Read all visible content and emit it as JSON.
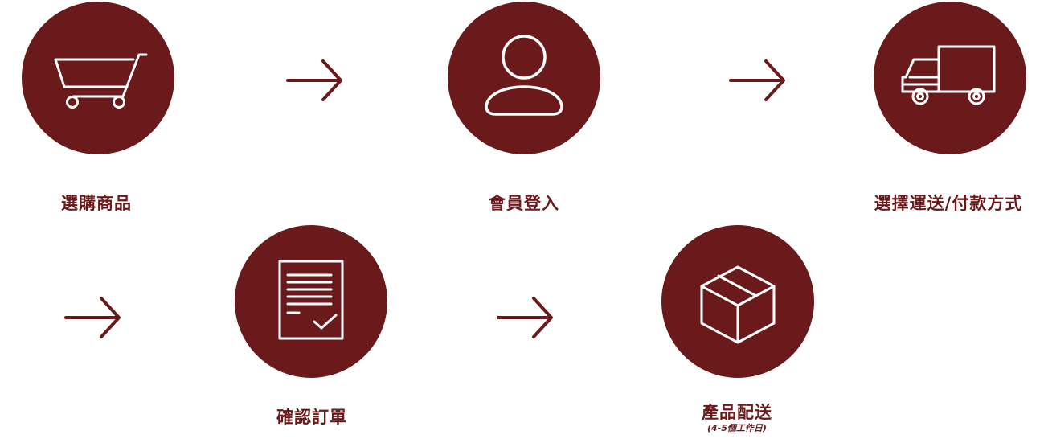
{
  "steps": [
    {
      "label": "選購商品",
      "icon": "shopping-cart-icon"
    },
    {
      "label": "會員登入",
      "icon": "user-icon"
    },
    {
      "label": "選擇運送/付款方式",
      "icon": "delivery-truck-icon"
    },
    {
      "label": "確認訂單",
      "icon": "document-check-icon"
    },
    {
      "label": "產品配送",
      "note": "(4-5個工作日)",
      "icon": "package-box-icon"
    }
  ],
  "colors": {
    "accent": "#6b1a1c",
    "icon_stroke": "#ffffff",
    "background": "#ffffff"
  }
}
